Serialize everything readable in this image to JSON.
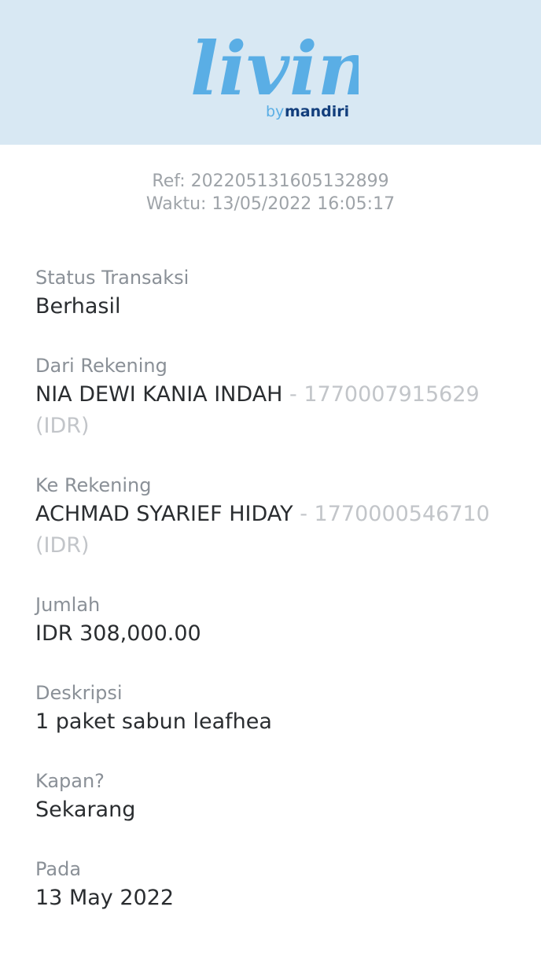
{
  "header": {
    "logo_text": "livin'",
    "logo_sub_by": "by",
    "logo_sub_brand": "mandiri"
  },
  "receipt": {
    "ref": "Ref: 202205131605132899",
    "time": "Waktu: 13/05/2022 16:05:17"
  },
  "fields": {
    "status": {
      "label": "Status Transaksi",
      "value": "Berhasil"
    },
    "from": {
      "label": "Dari Rekening",
      "name": "NIA DEWI KANIA INDAH",
      "account": " - 1770007915629",
      "currency": "(IDR)"
    },
    "to": {
      "label": "Ke Rekening",
      "name": "ACHMAD SYARIEF HIDAY",
      "account": " - 1770000546710",
      "currency": "(IDR)"
    },
    "amount": {
      "label": "Jumlah",
      "value": "IDR 308,000.00"
    },
    "description": {
      "label": "Deskripsi",
      "value": "1 paket sabun leafhea"
    },
    "when": {
      "label": "Kapan?",
      "value": "Sekarang"
    },
    "date": {
      "label": "Pada",
      "value": "13 May 2022"
    }
  },
  "colors": {
    "header_bg": "#d8e8f3",
    "logo_blue": "#5aaee5",
    "logo_accent": "#f7b500",
    "mandiri_navy": "#123e7c"
  }
}
